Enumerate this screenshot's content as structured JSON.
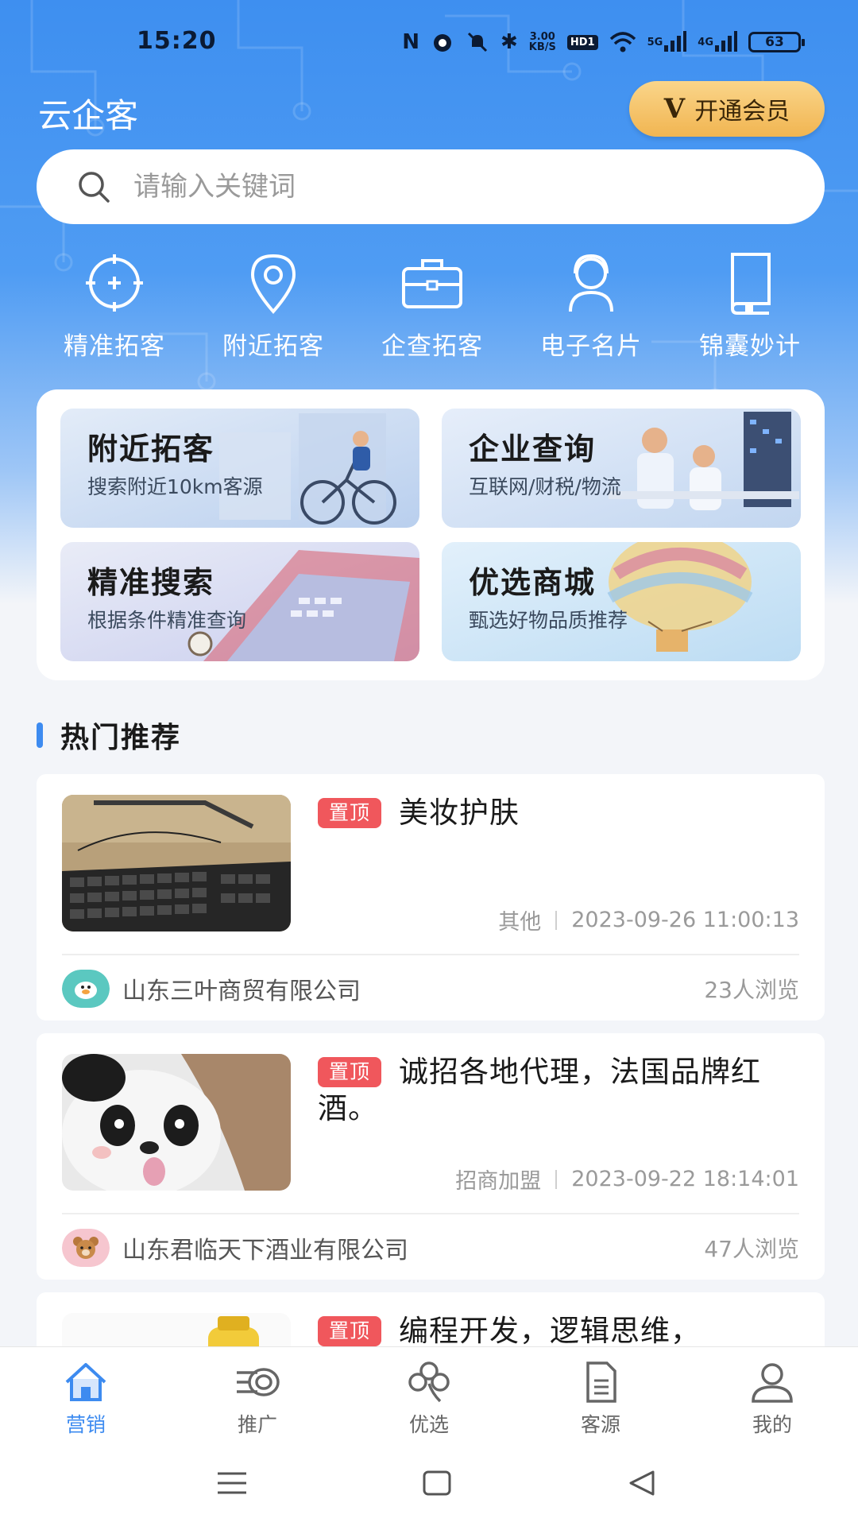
{
  "status_bar": {
    "time": "15:20",
    "net_speed_value": "3.00",
    "net_speed_unit": "KB/S",
    "hd_label": "HD1",
    "sig1": "5G",
    "sig2": "4G",
    "battery": "63"
  },
  "header": {
    "app_title": "云企客",
    "vip_mark": "V",
    "vip_label": "开通会员"
  },
  "search": {
    "placeholder": "请输入关键词"
  },
  "quick_actions": [
    {
      "label": "精准拓客",
      "icon": "crosshair-icon"
    },
    {
      "label": "附近拓客",
      "icon": "location-pin-icon"
    },
    {
      "label": "企查拓客",
      "icon": "briefcase-icon"
    },
    {
      "label": "电子名片",
      "icon": "person-headset-icon"
    },
    {
      "label": "锦囊妙计",
      "icon": "book-icon"
    }
  ],
  "feature_cards": [
    {
      "title": "附近拓客",
      "subtitle": "搜索附近10km客源"
    },
    {
      "title": "企业查询",
      "subtitle": "互联网/财税/物流"
    },
    {
      "title": "精准搜索",
      "subtitle": "根据条件精准查询"
    },
    {
      "title": "优选商城",
      "subtitle": "甄选好物品质推荐"
    }
  ],
  "section": {
    "title": "热门推荐"
  },
  "posts": [
    {
      "pin": "置顶",
      "title": "美妆护肤",
      "category": "其他",
      "datetime": "2023-09-26 11:00:13",
      "company": "山东三叶商贸有限公司",
      "views": "23人浏览"
    },
    {
      "pin": "置顶",
      "title": "诚招各地代理，法国品牌红酒。",
      "category": "招商加盟",
      "datetime": "2023-09-22 18:14:01",
      "company": "山东君临天下酒业有限公司",
      "views": "47人浏览"
    },
    {
      "pin": "置顶",
      "title": "编程开发，逻辑思维，"
    }
  ],
  "tabbar": [
    {
      "label": "营销",
      "icon": "home-icon",
      "active": true
    },
    {
      "label": "推广",
      "icon": "megaphone-icon"
    },
    {
      "label": "优选",
      "icon": "clover-icon"
    },
    {
      "label": "客源",
      "icon": "document-icon"
    },
    {
      "label": "我的",
      "icon": "user-icon"
    }
  ],
  "colors": {
    "accent": "#3d8bf0",
    "pin_red": "#f0575c",
    "vip_gold": "#f1b551"
  }
}
